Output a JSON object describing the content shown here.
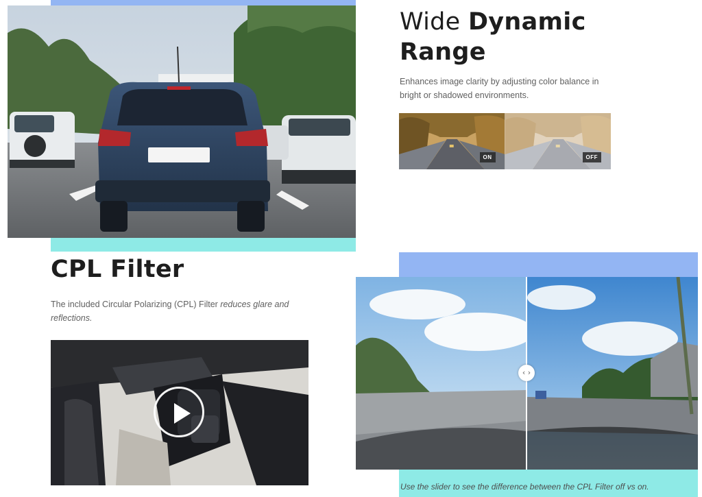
{
  "wdr": {
    "title_light": "Wide ",
    "title_bold_1": "Dynamic",
    "title_bold_2": "Range",
    "description": "Enhances image clarity by adjusting color balance in bright or shadowed environments.",
    "tag_on": "ON",
    "tag_off": "OFF"
  },
  "cpl": {
    "title": "CPL Filter",
    "description_plain": " The included Circular Polarizing (CPL) Filter ",
    "description_italic": "reduces glare and reflections.",
    "caption": "Use the slider to see the difference between the CPL Filter off vs on.",
    "slider_handle_glyph": "‹ ›"
  },
  "colors": {
    "accent_blue": "#93b5f3",
    "accent_cyan": "#8eeae6",
    "heading": "#1e1e1e",
    "body_text": "#5f5f5f"
  },
  "icons": {
    "video_play": "play-icon",
    "slider": "chevrons-left-right-icon"
  }
}
